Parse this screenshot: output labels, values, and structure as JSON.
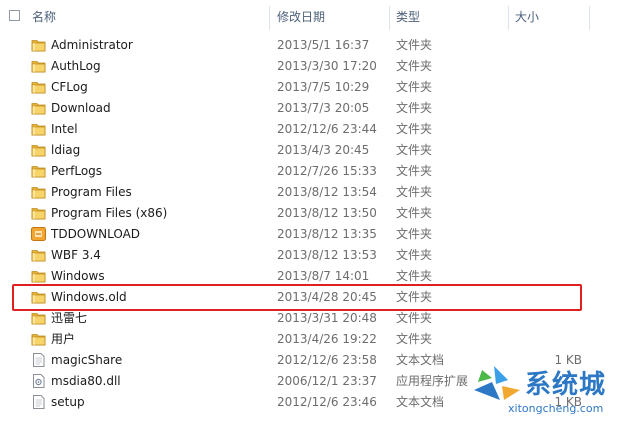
{
  "columns": {
    "name": "名称",
    "date": "修改日期",
    "type": "类型",
    "size": "大小"
  },
  "files": [
    {
      "name": "Administrator",
      "date": "2013/5/1 16:37",
      "type": "文件夹",
      "size": "",
      "icon": "folder-icon"
    },
    {
      "name": "AuthLog",
      "date": "2013/3/30 17:20",
      "type": "文件夹",
      "size": "",
      "icon": "folder-icon"
    },
    {
      "name": "CFLog",
      "date": "2013/7/5 10:29",
      "type": "文件夹",
      "size": "",
      "icon": "folder-icon"
    },
    {
      "name": "Download",
      "date": "2013/7/3 20:05",
      "type": "文件夹",
      "size": "",
      "icon": "folder-icon"
    },
    {
      "name": "Intel",
      "date": "2012/12/6 23:44",
      "type": "文件夹",
      "size": "",
      "icon": "folder-icon"
    },
    {
      "name": "ldiag",
      "date": "2013/4/3 20:45",
      "type": "文件夹",
      "size": "",
      "icon": "folder-icon"
    },
    {
      "name": "PerfLogs",
      "date": "2012/7/26 15:33",
      "type": "文件夹",
      "size": "",
      "icon": "folder-icon"
    },
    {
      "name": "Program Files",
      "date": "2013/8/12 13:54",
      "type": "文件夹",
      "size": "",
      "icon": "folder-icon"
    },
    {
      "name": "Program Files (x86)",
      "date": "2013/8/12 13:50",
      "type": "文件夹",
      "size": "",
      "icon": "folder-icon"
    },
    {
      "name": "TDDOWNLOAD",
      "date": "2013/8/12 13:35",
      "type": "文件夹",
      "size": "",
      "icon": "special-folder-icon"
    },
    {
      "name": "WBF 3.4",
      "date": "2013/8/12 13:53",
      "type": "文件夹",
      "size": "",
      "icon": "folder-icon"
    },
    {
      "name": "Windows",
      "date": "2013/8/7 14:01",
      "type": "文件夹",
      "size": "",
      "icon": "folder-icon"
    },
    {
      "name": "Windows.old",
      "date": "2013/4/28 20:45",
      "type": "文件夹",
      "size": "",
      "icon": "folder-icon"
    },
    {
      "name": "迅雷七",
      "date": "2013/3/31 20:48",
      "type": "文件夹",
      "size": "",
      "icon": "folder-icon"
    },
    {
      "name": "用户",
      "date": "2013/4/26 19:22",
      "type": "文件夹",
      "size": "",
      "icon": "folder-icon"
    },
    {
      "name": "magicShare",
      "date": "2012/12/6 23:58",
      "type": "文本文档",
      "size": "1 KB",
      "icon": "text-file-icon"
    },
    {
      "name": "msdia80.dll",
      "date": "2006/12/1 23:37",
      "type": "应用程序扩展",
      "size": "",
      "icon": "dll-file-icon"
    },
    {
      "name": "setup",
      "date": "2012/12/6 23:46",
      "type": "文本文档",
      "size": "1 KB",
      "icon": "text-file-icon"
    }
  ],
  "highlight_color": "#e02020",
  "watermark": {
    "title": "系统城",
    "url": "xitongcheng.com"
  }
}
